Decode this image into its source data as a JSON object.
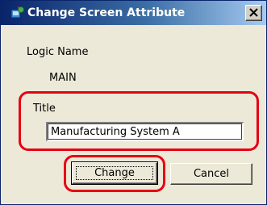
{
  "window": {
    "title": "Change Screen Attribute",
    "close_symbol": "×"
  },
  "form": {
    "logic_name_label": "Logic Name",
    "logic_name_value": "MAIN",
    "title_label": "Title",
    "title_value": "Manufacturing System A"
  },
  "buttons": {
    "change_label": "Change",
    "cancel_label": "Cancel"
  },
  "icons": {
    "app": "app-screen-icon",
    "close": "close-icon"
  },
  "colors": {
    "titlebar_start": "#0a246a",
    "titlebar_end": "#a6caf0",
    "dialog_bg": "#ece9d8",
    "highlight": "#e60012"
  }
}
